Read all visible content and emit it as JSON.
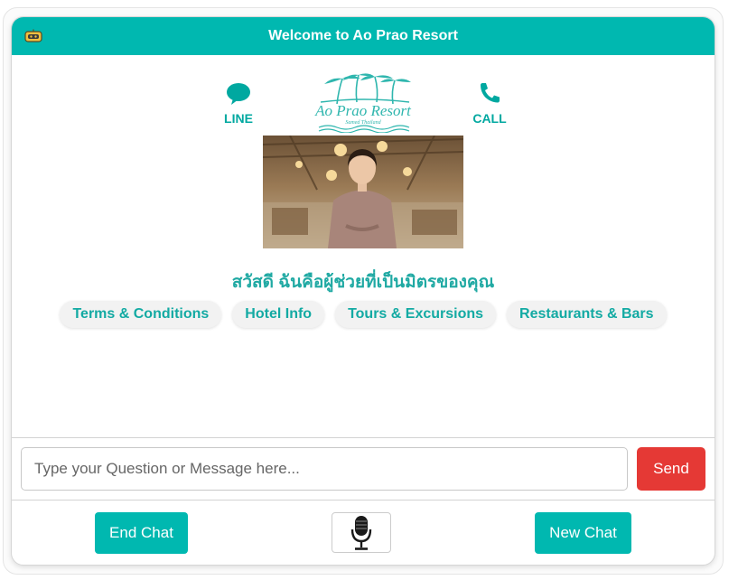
{
  "header": {
    "title": "Welcome to Ao Prao Resort",
    "icon": "bot-icon"
  },
  "contacts": {
    "line_label": "LINE",
    "line_icon": "chat-bubble-icon",
    "call_label": "CALL",
    "call_icon": "phone-icon"
  },
  "logo": {
    "name": "Ao Prao Resort",
    "tagline": "Samed Thailand"
  },
  "greeting": "สวัสดี ฉันคือผู้ช่วยที่เป็นมิตรของคุณ",
  "quick_replies": [
    "Terms & Conditions",
    "Hotel Info",
    "Tours & Excursions",
    "Restaurants & Bars"
  ],
  "input": {
    "placeholder": "Type your Question or Message here...",
    "value": ""
  },
  "buttons": {
    "send": "Send",
    "end_chat": "End Chat",
    "new_chat": "New Chat",
    "mic_icon": "microphone-icon"
  },
  "colors": {
    "accent": "#00b8b0",
    "send": "#e53935"
  }
}
